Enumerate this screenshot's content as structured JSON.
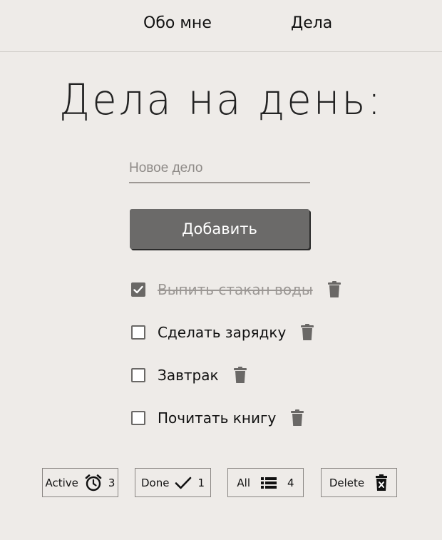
{
  "nav": {
    "about": "Обо мне",
    "tasks": "Дела"
  },
  "title": "Дела на день:",
  "new_task": {
    "placeholder": "Новое дело",
    "value": ""
  },
  "add_button": "Добавить",
  "todos": [
    {
      "text": "Выпить стакан воды",
      "done": true
    },
    {
      "text": "Сделать зарядку",
      "done": false
    },
    {
      "text": "Завтрак",
      "done": false
    },
    {
      "text": "Почитать книгу",
      "done": false
    }
  ],
  "filters": {
    "active": {
      "label": "Active",
      "count": "3",
      "icon": "alarm-clock-icon"
    },
    "done": {
      "label": "Done",
      "count": "1",
      "icon": "checkmark-icon"
    },
    "all": {
      "label": "All",
      "count": "4",
      "icon": "list-icon"
    },
    "delete": {
      "label": "Delete",
      "icon": "trash-x-icon"
    }
  },
  "colors": {
    "background": "#eeebe8",
    "button": "#6b6a69",
    "icon": "#6a6866"
  }
}
